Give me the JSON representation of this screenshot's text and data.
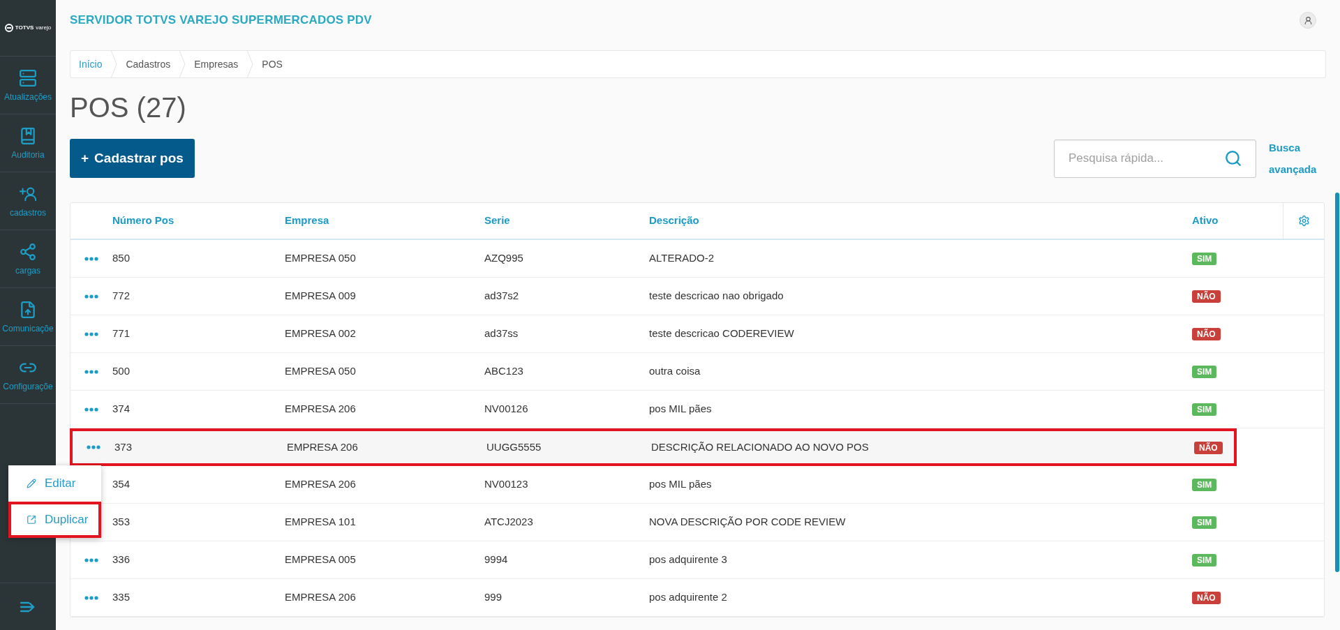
{
  "sidebar": {
    "logo": "TOTVS",
    "logo_sub": "varejo",
    "items": [
      {
        "label": "Atualizações"
      },
      {
        "label": "Auditoria"
      },
      {
        "label": "cadastros"
      },
      {
        "label": "cargas"
      },
      {
        "label": "Comunicaçõe"
      },
      {
        "label": "Configuraçõe"
      }
    ]
  },
  "header": {
    "title": "SERVIDOR TOTVS VAREJO SUPERMERCADOS PDV"
  },
  "breadcrumb": [
    {
      "label": "Início",
      "link": true
    },
    {
      "label": "Cadastros",
      "link": false
    },
    {
      "label": "Empresas",
      "link": false
    },
    {
      "label": "POS",
      "link": false
    }
  ],
  "page_title": "POS (27)",
  "add_button": {
    "icon": "+",
    "label": "Cadastrar pos"
  },
  "search": {
    "placeholder": "Pesquisa rápida..."
  },
  "advanced_search": "Busca avançada",
  "table": {
    "columns": [
      "Número Pos",
      "Empresa",
      "Serie",
      "Descrição",
      "Ativo"
    ],
    "rows": [
      {
        "numero": "850",
        "empresa": "EMPRESA 050",
        "serie": "AZQ995",
        "descricao": "ALTERADO-2",
        "ativo": {
          "label": "SIM",
          "color": "#5cb85c"
        },
        "highlighted": false
      },
      {
        "numero": "772",
        "empresa": "EMPRESA 009",
        "serie": "ad37s2",
        "descricao": "teste descricao nao obrigado",
        "ativo": {
          "label": "NÃO",
          "color": "#c9403a"
        },
        "highlighted": false
      },
      {
        "numero": "771",
        "empresa": "EMPRESA 002",
        "serie": "ad37ss",
        "descricao": "teste descricao CODEREVIEW",
        "ativo": {
          "label": "NÃO",
          "color": "#c9403a"
        },
        "highlighted": false
      },
      {
        "numero": "500",
        "empresa": "EMPRESA 050",
        "serie": "ABC123",
        "descricao": "outra coisa",
        "ativo": {
          "label": "SIM",
          "color": "#5cb85c"
        },
        "highlighted": false
      },
      {
        "numero": "374",
        "empresa": "EMPRESA 206",
        "serie": "NV00126",
        "descricao": "pos MIL pães",
        "ativo": {
          "label": "SIM",
          "color": "#5cb85c"
        },
        "highlighted": false
      },
      {
        "numero": "373",
        "empresa": "EMPRESA 206",
        "serie": "UUGG5555",
        "descricao": "DESCRIÇÃO RELACIONADO AO NOVO POS",
        "ativo": {
          "label": "NÃO",
          "color": "#c9403a"
        },
        "highlighted": true
      },
      {
        "numero": "354",
        "empresa": "EMPRESA 206",
        "serie": "NV00123",
        "descricao": "pos MIL pães",
        "ativo": {
          "label": "SIM",
          "color": "#5cb85c"
        },
        "highlighted": false
      },
      {
        "numero": "353",
        "empresa": "EMPRESA 101",
        "serie": "ATCJ2023",
        "descricao": "NOVA DESCRIÇÃO POR CODE REVIEW",
        "ativo": {
          "label": "SIM",
          "color": "#5cb85c"
        },
        "highlighted": false
      },
      {
        "numero": "336",
        "empresa": "EMPRESA 005",
        "serie": "9994",
        "descricao": "pos adquirente 3",
        "ativo": {
          "label": "SIM",
          "color": "#5cb85c"
        },
        "highlighted": false
      },
      {
        "numero": "335",
        "empresa": "EMPRESA 206",
        "serie": "999",
        "descricao": "pos adquirente 2",
        "ativo": {
          "label": "NÃO",
          "color": "#c9403a"
        },
        "highlighted": false
      }
    ]
  },
  "row_menu": [
    {
      "kind": "edit",
      "label": "Editar",
      "highlighted": false
    },
    {
      "kind": "duplicate",
      "label": "Duplicar",
      "highlighted": true
    }
  ]
}
